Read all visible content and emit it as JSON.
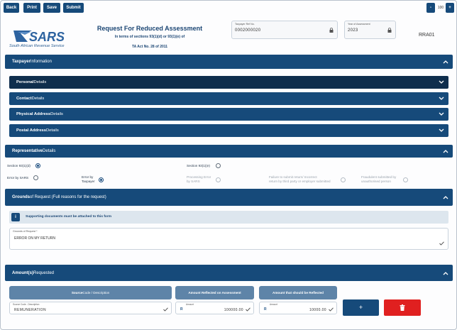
{
  "toolbar": {
    "back": "Back",
    "print": "Print",
    "save": "Save",
    "submit": "Submit",
    "zoom_out": "-",
    "zoom_value": "100",
    "zoom_in": "+"
  },
  "header": {
    "logo_alt": "SARS",
    "logo_caption": "South African Revenue Service",
    "title": "Request For Reduced Assessment",
    "subtitle_line1": "In terms of sections 93(1)(d) or 93(1)(e) of",
    "subtitle_line2": "TA Act No. 28 of 2011",
    "taxpayer_ref_label": "Taxpayer Ref No.",
    "taxpayer_ref_value": "0002000020",
    "year_label": "Year of Assessment",
    "year_value": "2023",
    "form_code": "RRA01"
  },
  "sections": {
    "taxpayer": {
      "bold": "Taxpayer",
      "rest": " Information"
    },
    "personal": {
      "bold": "Personal",
      "rest": " Details"
    },
    "contact": {
      "bold": "Contact",
      "rest": " Details"
    },
    "physical": {
      "bold": "Physical Address",
      "rest": " Details"
    },
    "postal": {
      "bold": "Postal Address",
      "rest": " Details"
    },
    "representative": {
      "bold": "Representative",
      "rest": " Details"
    },
    "grounds": {
      "bold": "Grounds",
      "rest": " of Request (Full reasons for the request)"
    },
    "amounts": {
      "bold": "Amount(s)",
      "rest": " Requested"
    }
  },
  "radios": {
    "section_93_1_d": "Section 93(1)(d)",
    "section_93_1_e": "Section 93(1)(e)",
    "error_by_sars": "Error by SARS",
    "error_by_taxpayer_l1": "Error by",
    "error_by_taxpayer_l2": "Taxpayer",
    "processing_error_l1": "Processing Error",
    "processing_error_l2": "by SARS",
    "failure_l1": "Failure to submit return/ Incorrect",
    "failure_l2": "return by third party or employer submitted",
    "fraudulent_l1": "Fraudulent submitted by",
    "fraudulent_l2": "unauthorised person"
  },
  "grounds": {
    "info_text": "Supporting documents must be attached to this form",
    "field_label": "Grounds of Request *",
    "field_value": "ERROR ON MY RETURN"
  },
  "amounts": {
    "col1_header_bold": "Source",
    "col1_header_rest": " Code / Description",
    "col2_header": "Amount Reflected on Assessment",
    "col3_header": "Amount that should be Reflected",
    "col1_label": "Source Code - Description",
    "col1_value": "REMUNERATION",
    "col2_label": "Amount",
    "col2_currency": "R",
    "col2_value": "100000.00",
    "col3_label": "Amount",
    "col3_currency": "R",
    "col3_value": "10000.00",
    "add_label": "+"
  },
  "colors": {
    "primary": "#164a7a",
    "dark_bar": "#0f2e4d",
    "table_header": "#5e84a8",
    "delete": "#e02020"
  }
}
